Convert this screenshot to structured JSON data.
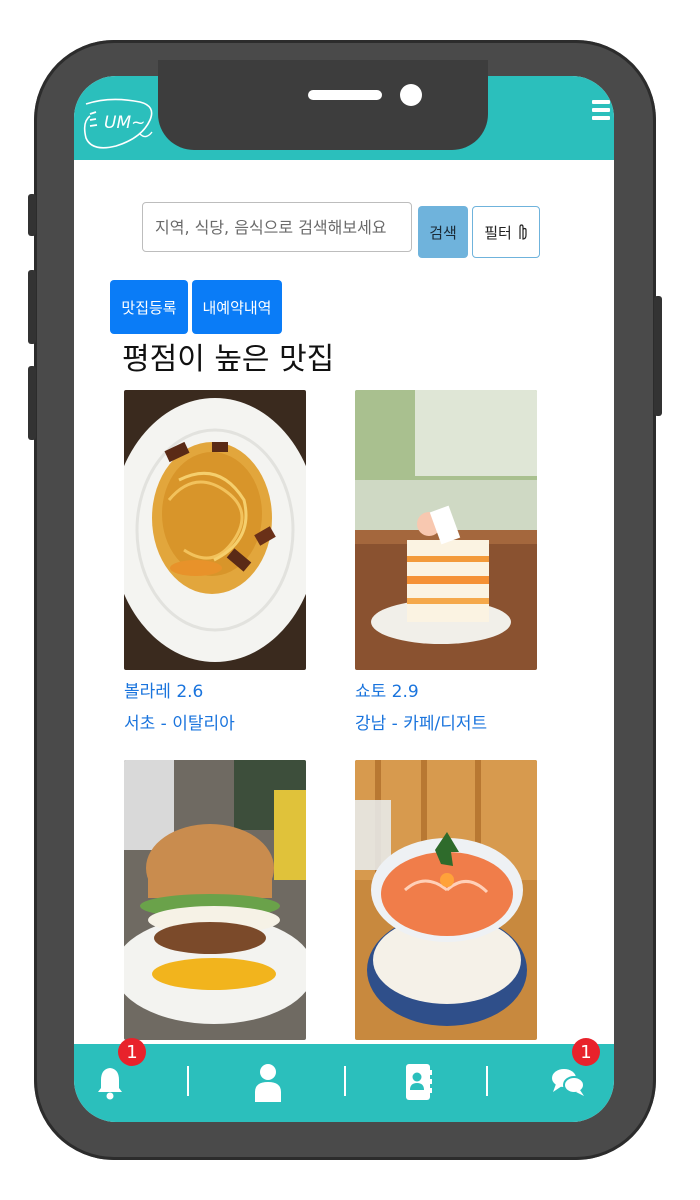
{
  "header": {
    "logo_text": "UM~",
    "menu_icon": "hamburger-menu-icon"
  },
  "search": {
    "placeholder": "지역, 식당, 음식으로 검색해보세요",
    "value": "",
    "search_label": "검색",
    "filter_label": "필터"
  },
  "actions": {
    "register_label": "맛집등록",
    "reservations_label": "내예약내역"
  },
  "section_title": "평점이 높은 맛집",
  "restaurants": [
    {
      "name_rating": "볼라레 2.6",
      "location": "서초 - 이탈리아",
      "photo": "carbonara-pasta"
    },
    {
      "name_rating": "쇼토 2.9",
      "location": "강남 - 카페/디저트",
      "photo": "strawberry-shortcake"
    },
    {
      "name_rating": "",
      "location": "",
      "photo": "egg-burger"
    },
    {
      "name_rating": "",
      "location": "",
      "photo": "salmon-rice-bowl"
    }
  ],
  "bottom_nav": {
    "items": [
      "bell-icon",
      "user-icon",
      "contacts-book-icon",
      "chat-icon"
    ],
    "notifications_badge": "1",
    "chat_badge": "1"
  },
  "colors": {
    "brand_teal": "#2bbfbc",
    "primary_blue": "#0a7cf7",
    "link_blue": "#1a74dd",
    "badge_red": "#e8222b"
  }
}
